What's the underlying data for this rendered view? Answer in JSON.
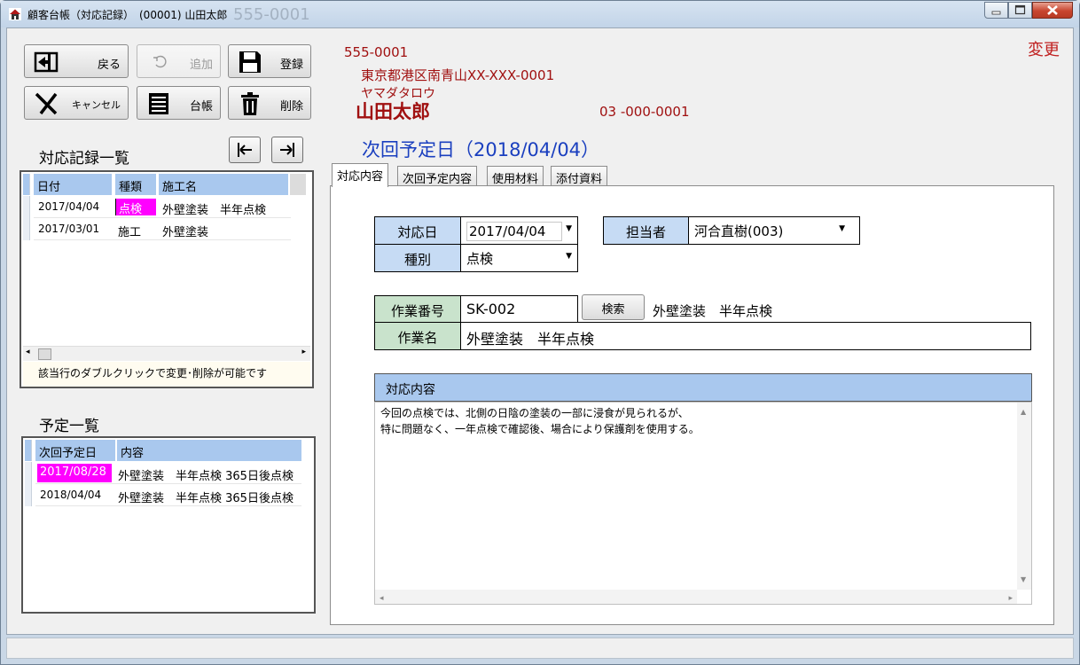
{
  "window": {
    "title": "顧客台帳（対応記録）　(00001) 山田太郎",
    "ghost_text": "555-0001"
  },
  "toolbar": {
    "back": "戻る",
    "add": "追加",
    "save": "登録",
    "cancel": "キャンセル",
    "ledger": "台帳",
    "delete": "削除"
  },
  "customer": {
    "postal": "555-0001",
    "address": "東京都港区南青山XX-XXX-0001",
    "kana": "ヤマダタロウ",
    "name": "山田太郎",
    "phone": "03 -000-0001",
    "mode": "変更"
  },
  "history": {
    "title": "対応記録一覧",
    "columns": [
      "日付",
      "種類",
      "施工名"
    ],
    "rows": [
      {
        "date": "2017/04/04",
        "type": "点検",
        "work": "外壁塗装　半年点検",
        "type_highlight": "#ff00ff"
      },
      {
        "date": "2017/03/01",
        "type": "施工",
        "work": "外壁塗装"
      }
    ],
    "hint": "該当行のダブルクリックで変更･削除が可能です"
  },
  "schedule": {
    "title": "予定一覧",
    "columns": [
      "次回予定日",
      "内容"
    ],
    "rows": [
      {
        "date": "2017/08/28",
        "content": "外壁塗装　半年点検 365日後点検",
        "date_highlight": "#ff00ff"
      },
      {
        "date": "2018/04/04",
        "content": "外壁塗装　半年点検 365日後点検"
      }
    ]
  },
  "next_date_heading": "次回予定日（2018/04/04）",
  "tabs": [
    "対応内容",
    "次回予定内容",
    "使用材料",
    "添付資料"
  ],
  "form": {
    "date_label": "対応日",
    "date_value": "2017/04/04",
    "type_label": "種別",
    "type_value": "点検",
    "staff_label": "担当者",
    "staff_value": "河合直樹(003)",
    "job_no_label": "作業番号",
    "job_no_value": "SK-002",
    "search_button": "検索",
    "job_lookup": "外壁塗装　半年点検",
    "job_name_label": "作業名",
    "job_name_value": "外壁塗装　半年点検",
    "content_label": "対応内容",
    "content_line1": "今回の点検では、北側の日陰の塗装の一部に浸食が見られるが、",
    "content_line2": "特に問題なく、一年点検で確認後、場合により保護剤を使用する。"
  },
  "colors": {
    "header_blue": "#a9c8ee",
    "label_blue": "#c6dbf4",
    "label_green": "#c9e3cc",
    "highlight_magenta": "#ff00ff",
    "customer_red": "#a01010",
    "heading_blue": "#1a3fbf"
  }
}
